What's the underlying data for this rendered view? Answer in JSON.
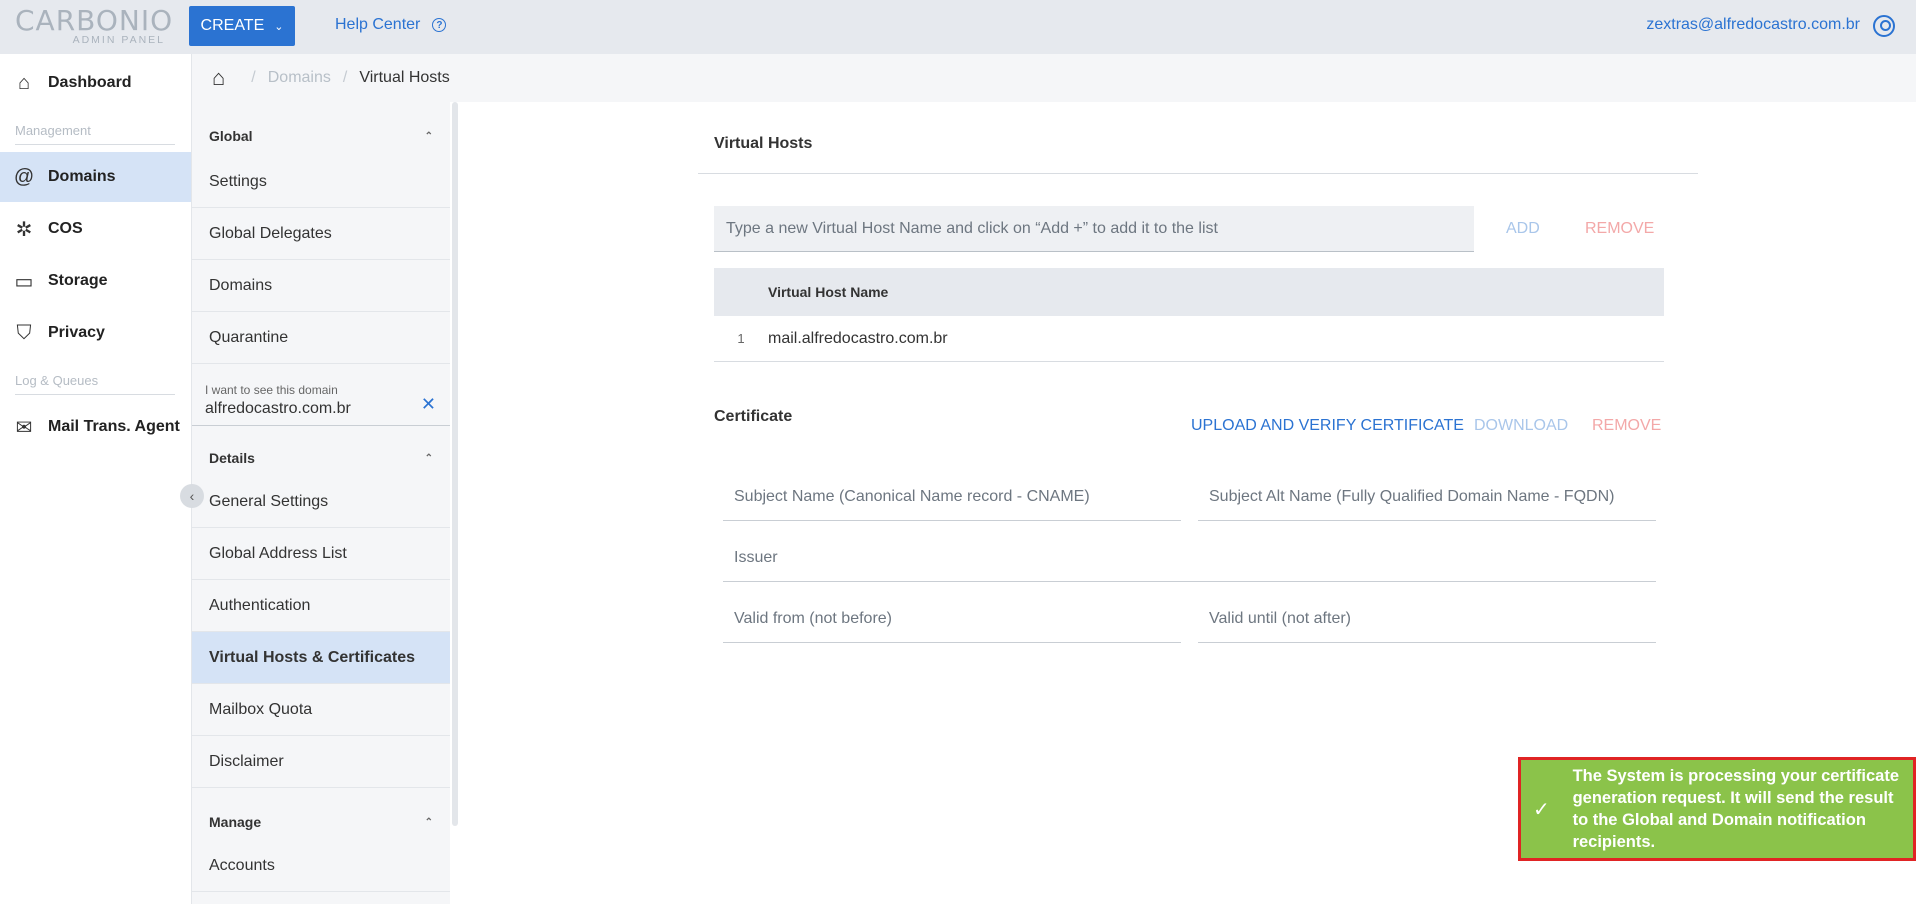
{
  "topbar": {
    "logo_main": "CARBONIO",
    "logo_sub": "ADMIN PANEL",
    "create_label": "CREATE",
    "help_label": "Help Center",
    "user_email": "zextras@alfredocastro.com.br"
  },
  "leftnav": {
    "dashboard": "Dashboard",
    "section_management": "Management",
    "domains": "Domains",
    "cos": "COS",
    "storage": "Storage",
    "privacy": "Privacy",
    "section_log": "Log & Queues",
    "mta": "Mail Trans. Agent"
  },
  "breadcrumb": {
    "domains": "Domains",
    "current": "Virtual Hosts"
  },
  "subpanel": {
    "global_header": "Global",
    "global_items": [
      "Settings",
      "Global Delegates",
      "Domains",
      "Quarantine"
    ],
    "domain_label": "I want to see this domain",
    "domain_value": "alfredocastro.com.br",
    "details_header": "Details",
    "details_items": [
      "General Settings",
      "Global Address List",
      "Authentication",
      "Virtual Hosts & Certificates",
      "Mailbox Quota",
      "Disclaimer"
    ],
    "manage_header": "Manage",
    "manage_items": [
      "Accounts"
    ]
  },
  "virtual_hosts": {
    "title": "Virtual Hosts",
    "input_placeholder": "Type a new Virtual Host Name and click on “Add +” to add it to the list",
    "add_label": "ADD",
    "remove_label": "REMOVE",
    "column_header": "Virtual Host Name",
    "rows": [
      {
        "num": "1",
        "name": "mail.alfredocastro.com.br"
      }
    ]
  },
  "certificate": {
    "title": "Certificate",
    "upload_label": "UPLOAD AND VERIFY CERTIFICATE",
    "download_label": "DOWNLOAD",
    "remove_label": "REMOVE",
    "subject_name": "Subject Name (Canonical Name record - CNAME)",
    "subject_alt": "Subject Alt Name (Fully Qualified Domain Name - FQDN)",
    "issuer": "Issuer",
    "valid_from": "Valid from (not before)",
    "valid_until": "Valid until (not after)"
  },
  "toast": {
    "message": "The System is processing your certificate generation request. It will send the result to the Global and Domain notification recipients."
  },
  "colors": {
    "accent": "#2b73d2",
    "active_bg": "#d5e3f6",
    "toast_bg": "#8bc34a",
    "toast_border": "#e02424",
    "remove_red": "#f3a8a8"
  }
}
